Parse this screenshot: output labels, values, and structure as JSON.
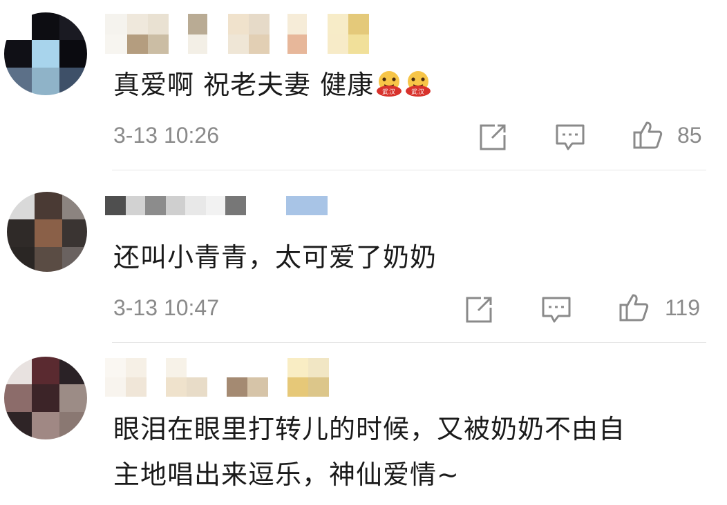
{
  "comments": [
    {
      "text": "真爱啊  祝老夫妻  健康",
      "emoji_icons": [
        "wuhan-badge-emoji-icon",
        "wuhan-badge-emoji-icon"
      ],
      "emoji_badge_text": "武汉",
      "time": "3-13 10:26",
      "likes": "85"
    },
    {
      "text": "还叫小青青，太可爱了奶奶",
      "time": "3-13 10:47",
      "likes": "119"
    },
    {
      "text_line1": "眼泪在眼里打转儿的时候，又被奶奶不由自",
      "text_line2": "主地唱出来逗乐，神仙爱情~"
    }
  ],
  "icons": {
    "share": "share-icon",
    "reply": "comment-icon",
    "like": "thumbs-up-icon"
  },
  "colors": {
    "text": "#1a1a1a",
    "meta": "#8a8a8a",
    "divider": "#e6e6e6"
  }
}
